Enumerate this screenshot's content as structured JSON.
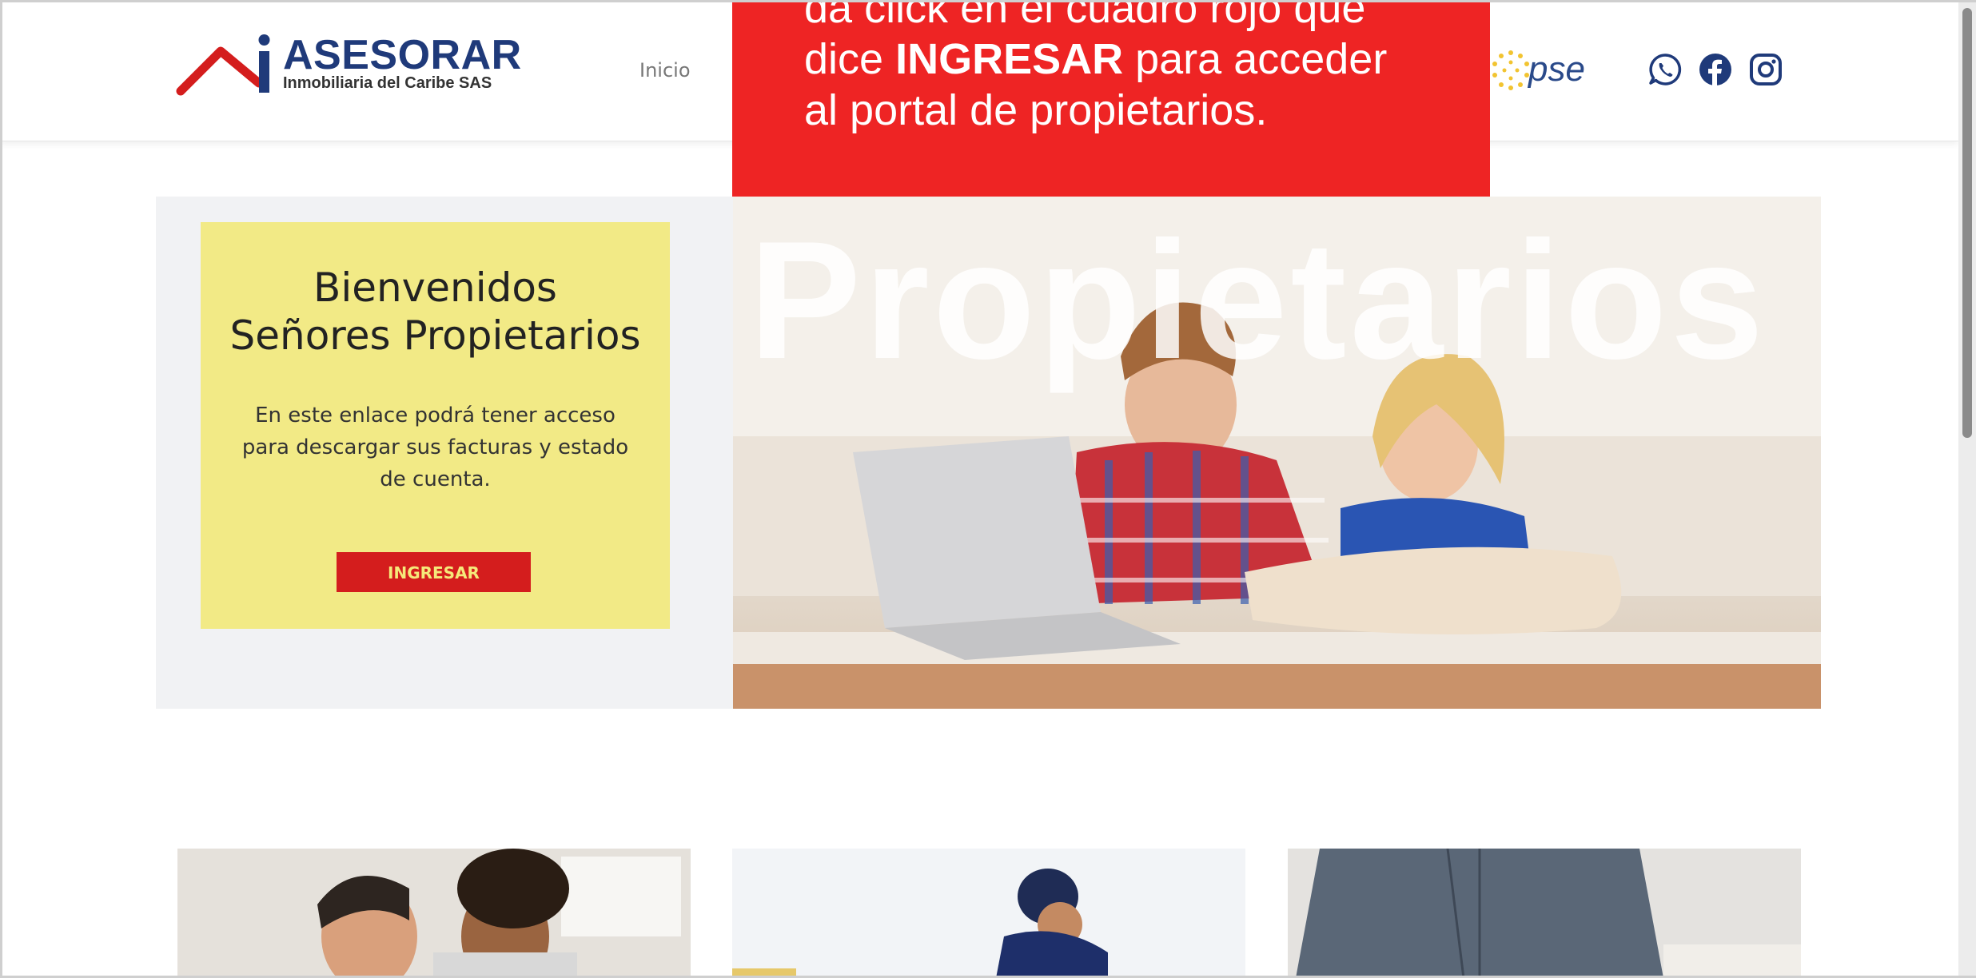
{
  "header": {
    "logo": {
      "name": "ASESORAR",
      "subtitle": "Inmobiliaria del Caribe SAS"
    },
    "nav": {
      "inicio": "Inicio"
    },
    "payment": {
      "label": "pse"
    },
    "social": [
      {
        "icon": "whatsapp-icon"
      },
      {
        "icon": "facebook-icon"
      },
      {
        "icon": "instagram-icon"
      }
    ]
  },
  "popup": {
    "line1": "da click en el cuadro rojo que",
    "line2_prefix": "dice ",
    "line2_bold": "INGRESAR",
    "line2_suffix": " para acceder",
    "line3": "al portal de propietarios."
  },
  "hero": {
    "welcome_title_line1": "Bienvenidos",
    "welcome_title_line2": "Señores Propietarios",
    "welcome_desc": "En este enlace podrá tener acceso para descargar sus facturas y estado de cuenta.",
    "button_label": "INGRESAR",
    "photo_word": "Propietarios"
  },
  "colors": {
    "brand_blue": "#1f3a7a",
    "brand_red": "#d41d1d",
    "popup_red": "#ee2424",
    "welcome_yellow": "#f2ea86",
    "hero_bg": "#f1f2f4"
  }
}
